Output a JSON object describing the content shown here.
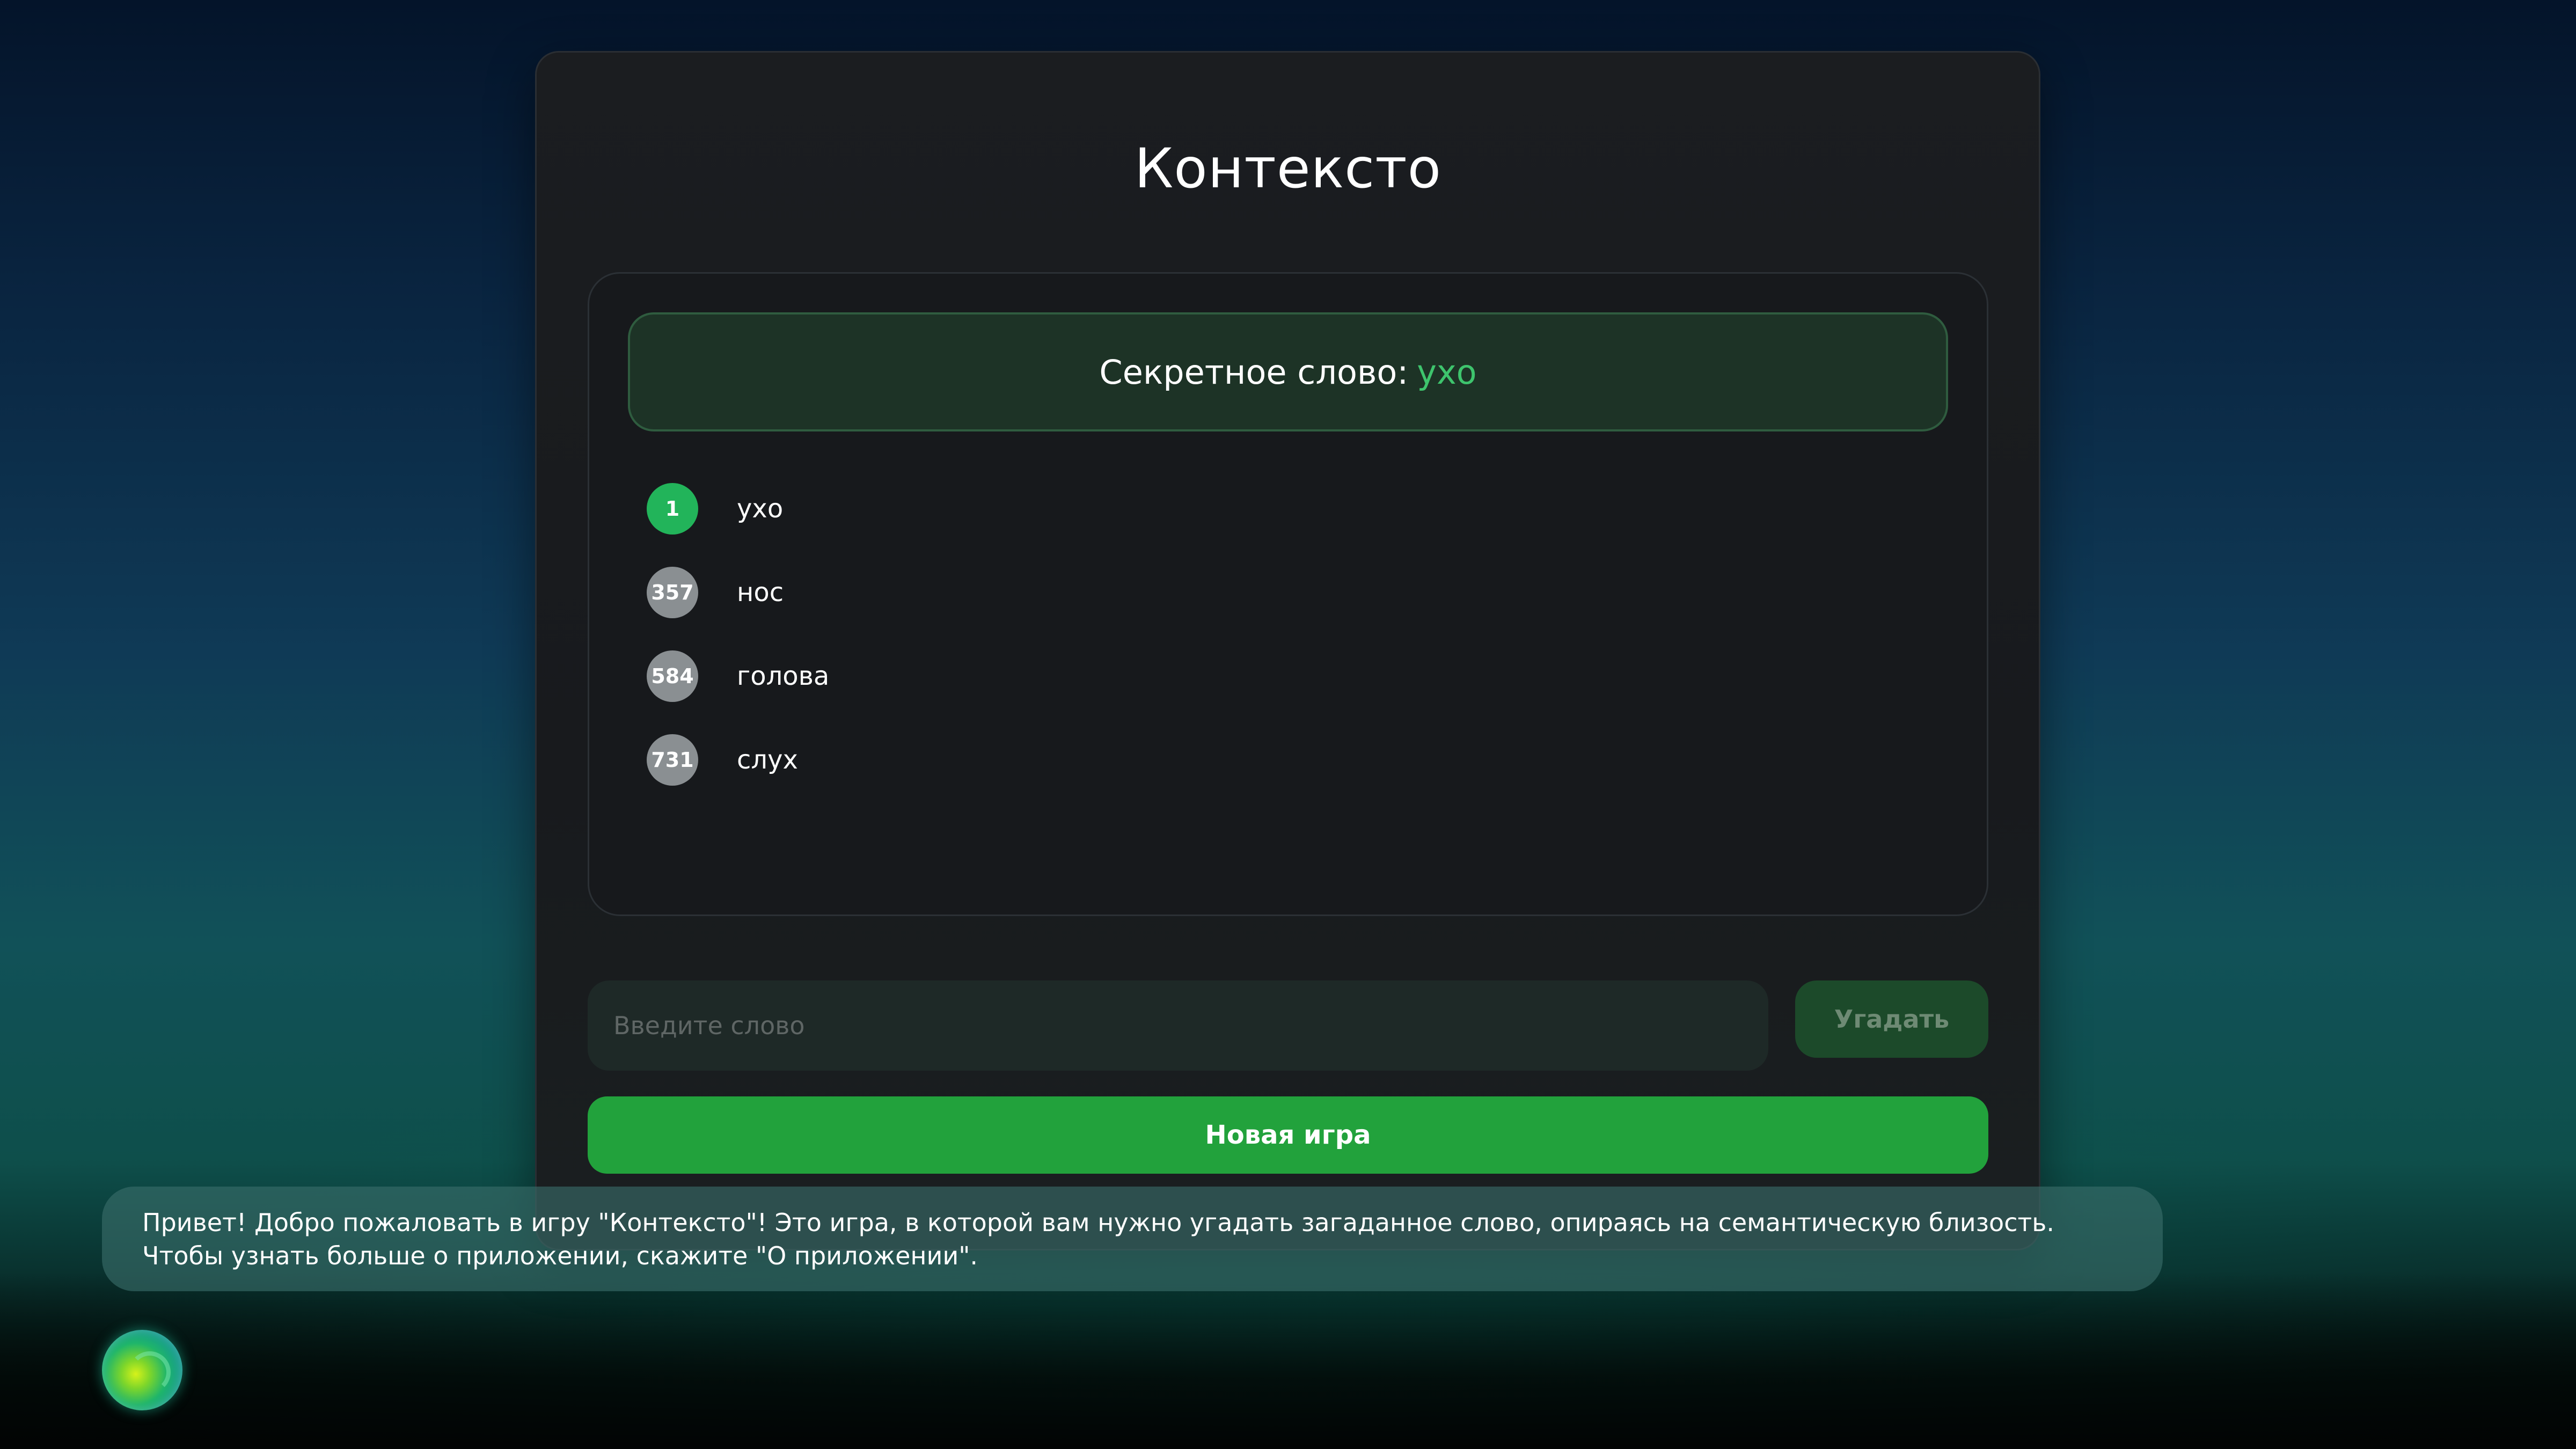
{
  "app": {
    "title": "Контексто"
  },
  "secret": {
    "label": "Секретное слово:",
    "word": "ухо"
  },
  "guesses": [
    {
      "rank": "1",
      "word": "ухо",
      "status": "best"
    },
    {
      "rank": "357",
      "word": "нос",
      "status": "far"
    },
    {
      "rank": "584",
      "word": "голова",
      "status": "far"
    },
    {
      "rank": "731",
      "word": "слух",
      "status": "far"
    }
  ],
  "input": {
    "placeholder": "Введите слово",
    "value": ""
  },
  "buttons": {
    "guess_label": "Угадать",
    "new_game_label": "Новая игра"
  },
  "assistant": {
    "message_line1": "Привет! Добро пожаловать в игру \"Контексто\"! Это игра, в которой вам нужно угадать загаданное слово, опираясь на семантическую близость.",
    "message_line2": "Чтобы узнать больше о приложении, скажите \"О приложении\"."
  },
  "colors": {
    "accent_green": "#22a23c",
    "best_rank": "#22b45a",
    "far_rank": "#8a8f92",
    "secret_word": "#3ec46d"
  }
}
